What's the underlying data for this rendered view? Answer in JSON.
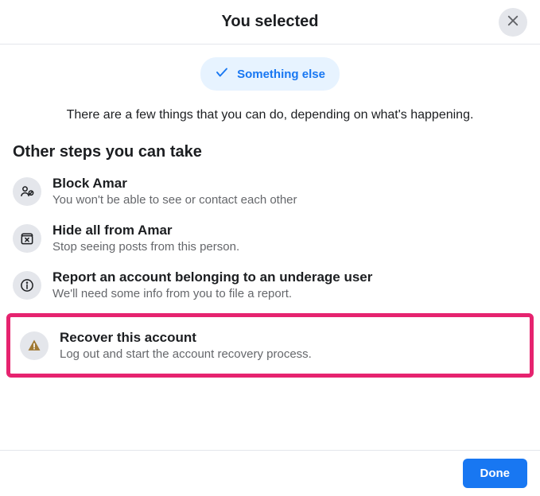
{
  "header": {
    "title": "You selected"
  },
  "chip": {
    "label": "Something else"
  },
  "description": "There are a few things that you can do, depending on what's happening.",
  "section_title": "Other steps you can take",
  "items": [
    {
      "title": "Block Amar",
      "subtitle": "You won't be able to see or contact each other"
    },
    {
      "title": "Hide all from Amar",
      "subtitle": "Stop seeing posts from this person."
    },
    {
      "title": "Report an account belonging to an underage user",
      "subtitle": "We'll need some info from you to file a report."
    },
    {
      "title": "Recover this account",
      "subtitle": "Log out and start the account recovery process."
    }
  ],
  "footer": {
    "done": "Done"
  }
}
